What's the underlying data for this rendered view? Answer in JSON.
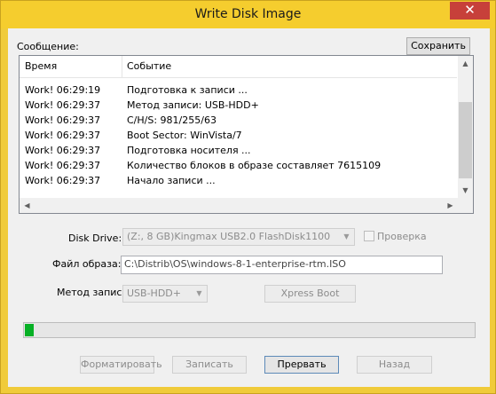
{
  "window": {
    "title": "Write Disk Image",
    "close_glyph": "✕"
  },
  "message_label": "Сообщение:",
  "save_button": "Сохранить",
  "log": {
    "columns": [
      "Время",
      "Событие"
    ],
    "rows": [
      {
        "time": "Work! 06:29:19",
        "event": "Подготовка к записи ..."
      },
      {
        "time": "Work! 06:29:37",
        "event": "Метод записи: USB-HDD+"
      },
      {
        "time": "Work! 06:29:37",
        "event": "C/H/S: 981/255/63"
      },
      {
        "time": "Work! 06:29:37",
        "event": "Boot Sector: WinVista/7"
      },
      {
        "time": "Work! 06:29:37",
        "event": "Подготовка носителя ..."
      },
      {
        "time": "Work! 06:29:37",
        "event": "Количество блоков в образе составляет 7615109"
      },
      {
        "time": "Work! 06:29:37",
        "event": "Начало записи ..."
      }
    ]
  },
  "disk_drive": {
    "label": "Disk Drive:",
    "value": "(Z:, 8 GB)Kingmax USB2.0 FlashDisk1100"
  },
  "verify_label": "Проверка",
  "image_file": {
    "label": "Файл образа:",
    "value": "C:\\Distrib\\OS\\windows-8-1-enterprise-rtm.ISO"
  },
  "write_method": {
    "label": "Метод записи:",
    "value": "USB-HDD+"
  },
  "xpress_boot_button": "Xpress Boot",
  "progress": {
    "fraction": 0.02
  },
  "buttons": {
    "format": "Форматировать",
    "write": "Записать",
    "abort": "Прервать",
    "back": "Назад"
  },
  "colors": {
    "title_bar": "#f5cd2e",
    "close": "#c7403a",
    "progress": "#06b025"
  }
}
